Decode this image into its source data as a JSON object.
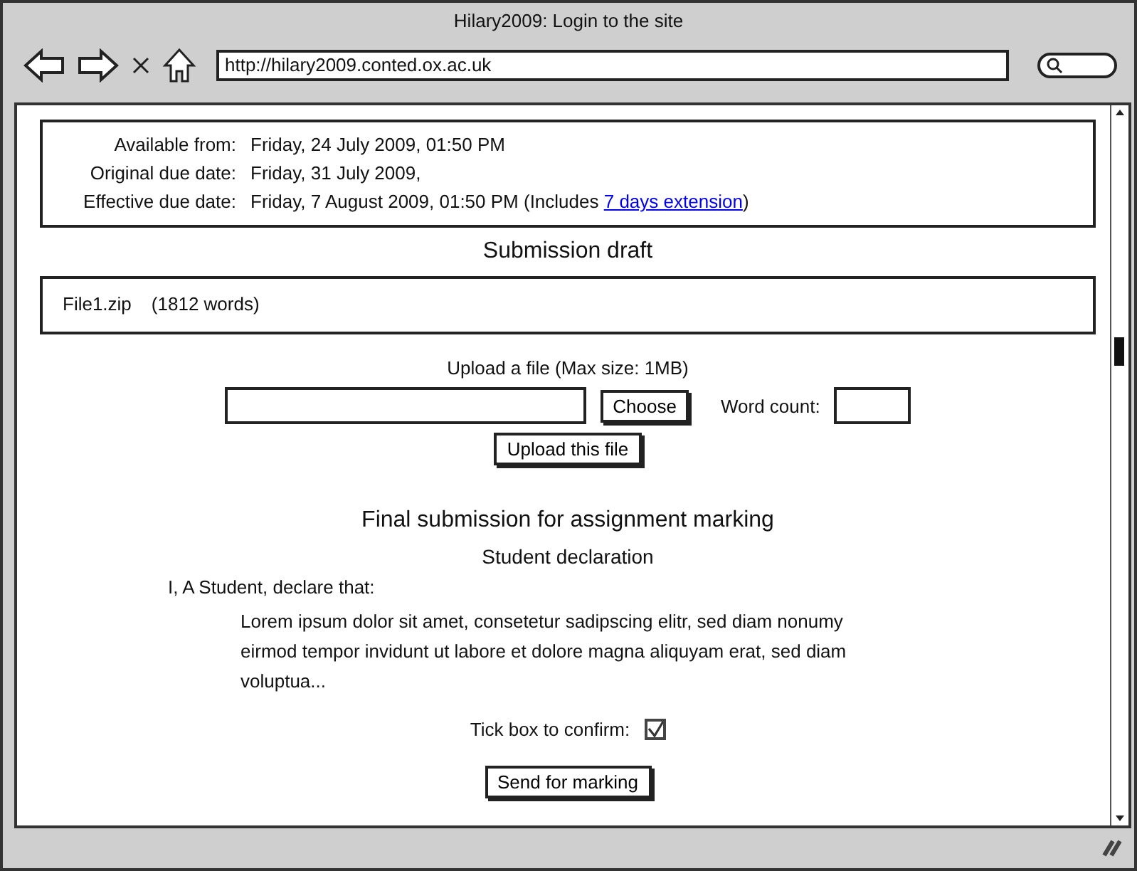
{
  "window": {
    "title": "Hilary2009: Login to the site"
  },
  "address_bar": {
    "value": "http://hilary2009.conted.ox.ac.uk"
  },
  "dates": [
    {
      "label": "Available from:",
      "value": "Friday, 24 July 2009, 01:50 PM"
    },
    {
      "label": "Original due date:",
      "value": "Friday, 31 July 2009,"
    },
    {
      "label": "Effective due date:",
      "value": "Friday, 7 August 2009, 01:50 PM (Includes ",
      "link": "7 days extension",
      "after": ")"
    }
  ],
  "draft": {
    "heading": "Submission draft",
    "files": [
      {
        "name": "File1.zip",
        "words": "(1812 words)"
      }
    ]
  },
  "upload": {
    "label": "Upload a file (Max size: 1MB)",
    "choose_button": "Choose",
    "word_count_label": "Word count:",
    "upload_button": "Upload this file"
  },
  "final": {
    "heading": "Final submission for assignment marking",
    "subheading": "Student declaration",
    "intro": "I, A Student, declare that:",
    "declaration": "Lorem ipsum dolor sit amet, consetetur sadipscing elitr, sed diam nonumy eirmod tempor invidunt ut labore et dolore magna aliquyam erat, sed diam voluptua...",
    "confirm": {
      "label": "Tick box to confirm:",
      "checked": true
    },
    "send_button": "Send for marking"
  }
}
